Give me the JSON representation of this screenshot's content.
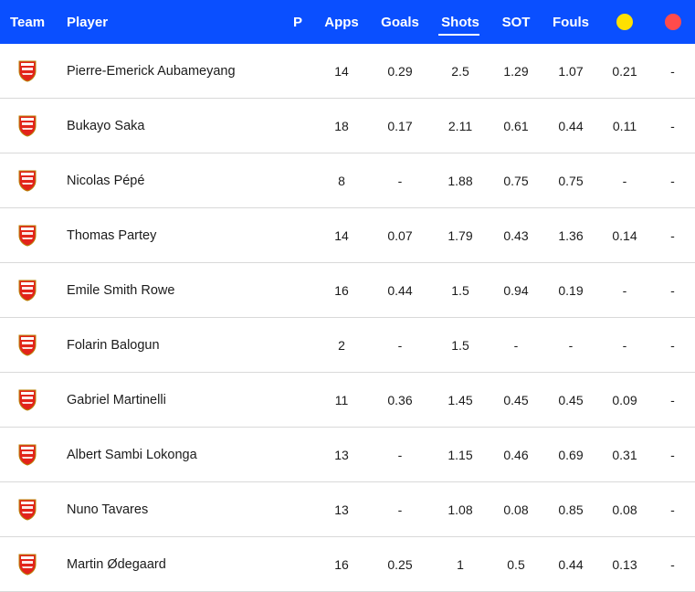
{
  "header": {
    "team": "Team",
    "player": "Player",
    "p": "P",
    "apps": "Apps",
    "goals": "Goals",
    "shots": "Shots",
    "sot": "SOT",
    "fouls": "Fouls",
    "yellow_card_color": "#ffe000",
    "red_card_color": "#ff4b4b"
  },
  "colors": {
    "header_bg": "#0a4fff",
    "crest_red": "#e2231a"
  },
  "rows": [
    {
      "team_icon": "arsenal-crest-icon",
      "player": "Pierre-Emerick Aubameyang",
      "apps": "14",
      "goals": "0.29",
      "shots": "2.5",
      "sot": "1.29",
      "fouls": "1.07",
      "yellow": "0.21",
      "red": "-"
    },
    {
      "team_icon": "arsenal-crest-icon",
      "player": "Bukayo Saka",
      "apps": "18",
      "goals": "0.17",
      "shots": "2.11",
      "sot": "0.61",
      "fouls": "0.44",
      "yellow": "0.11",
      "red": "-"
    },
    {
      "team_icon": "arsenal-crest-icon",
      "player": "Nicolas Pépé",
      "apps": "8",
      "goals": "-",
      "shots": "1.88",
      "sot": "0.75",
      "fouls": "0.75",
      "yellow": "-",
      "red": "-"
    },
    {
      "team_icon": "arsenal-crest-icon",
      "player": "Thomas Partey",
      "apps": "14",
      "goals": "0.07",
      "shots": "1.79",
      "sot": "0.43",
      "fouls": "1.36",
      "yellow": "0.14",
      "red": "-"
    },
    {
      "team_icon": "arsenal-crest-icon",
      "player": "Emile Smith Rowe",
      "apps": "16",
      "goals": "0.44",
      "shots": "1.5",
      "sot": "0.94",
      "fouls": "0.19",
      "yellow": "-",
      "red": "-"
    },
    {
      "team_icon": "arsenal-crest-icon",
      "player": "Folarin Balogun",
      "apps": "2",
      "goals": "-",
      "shots": "1.5",
      "sot": "-",
      "fouls": "-",
      "yellow": "-",
      "red": "-"
    },
    {
      "team_icon": "arsenal-crest-icon",
      "player": "Gabriel Martinelli",
      "apps": "11",
      "goals": "0.36",
      "shots": "1.45",
      "sot": "0.45",
      "fouls": "0.45",
      "yellow": "0.09",
      "red": "-"
    },
    {
      "team_icon": "arsenal-crest-icon",
      "player": "Albert Sambi Lokonga",
      "apps": "13",
      "goals": "-",
      "shots": "1.15",
      "sot": "0.46",
      "fouls": "0.69",
      "yellow": "0.31",
      "red": "-"
    },
    {
      "team_icon": "arsenal-crest-icon",
      "player": "Nuno Tavares",
      "apps": "13",
      "goals": "-",
      "shots": "1.08",
      "sot": "0.08",
      "fouls": "0.85",
      "yellow": "0.08",
      "red": "-"
    },
    {
      "team_icon": "arsenal-crest-icon",
      "player": "Martin Ødegaard",
      "apps": "16",
      "goals": "0.25",
      "shots": "1",
      "sot": "0.5",
      "fouls": "0.44",
      "yellow": "0.13",
      "red": "-"
    }
  ]
}
